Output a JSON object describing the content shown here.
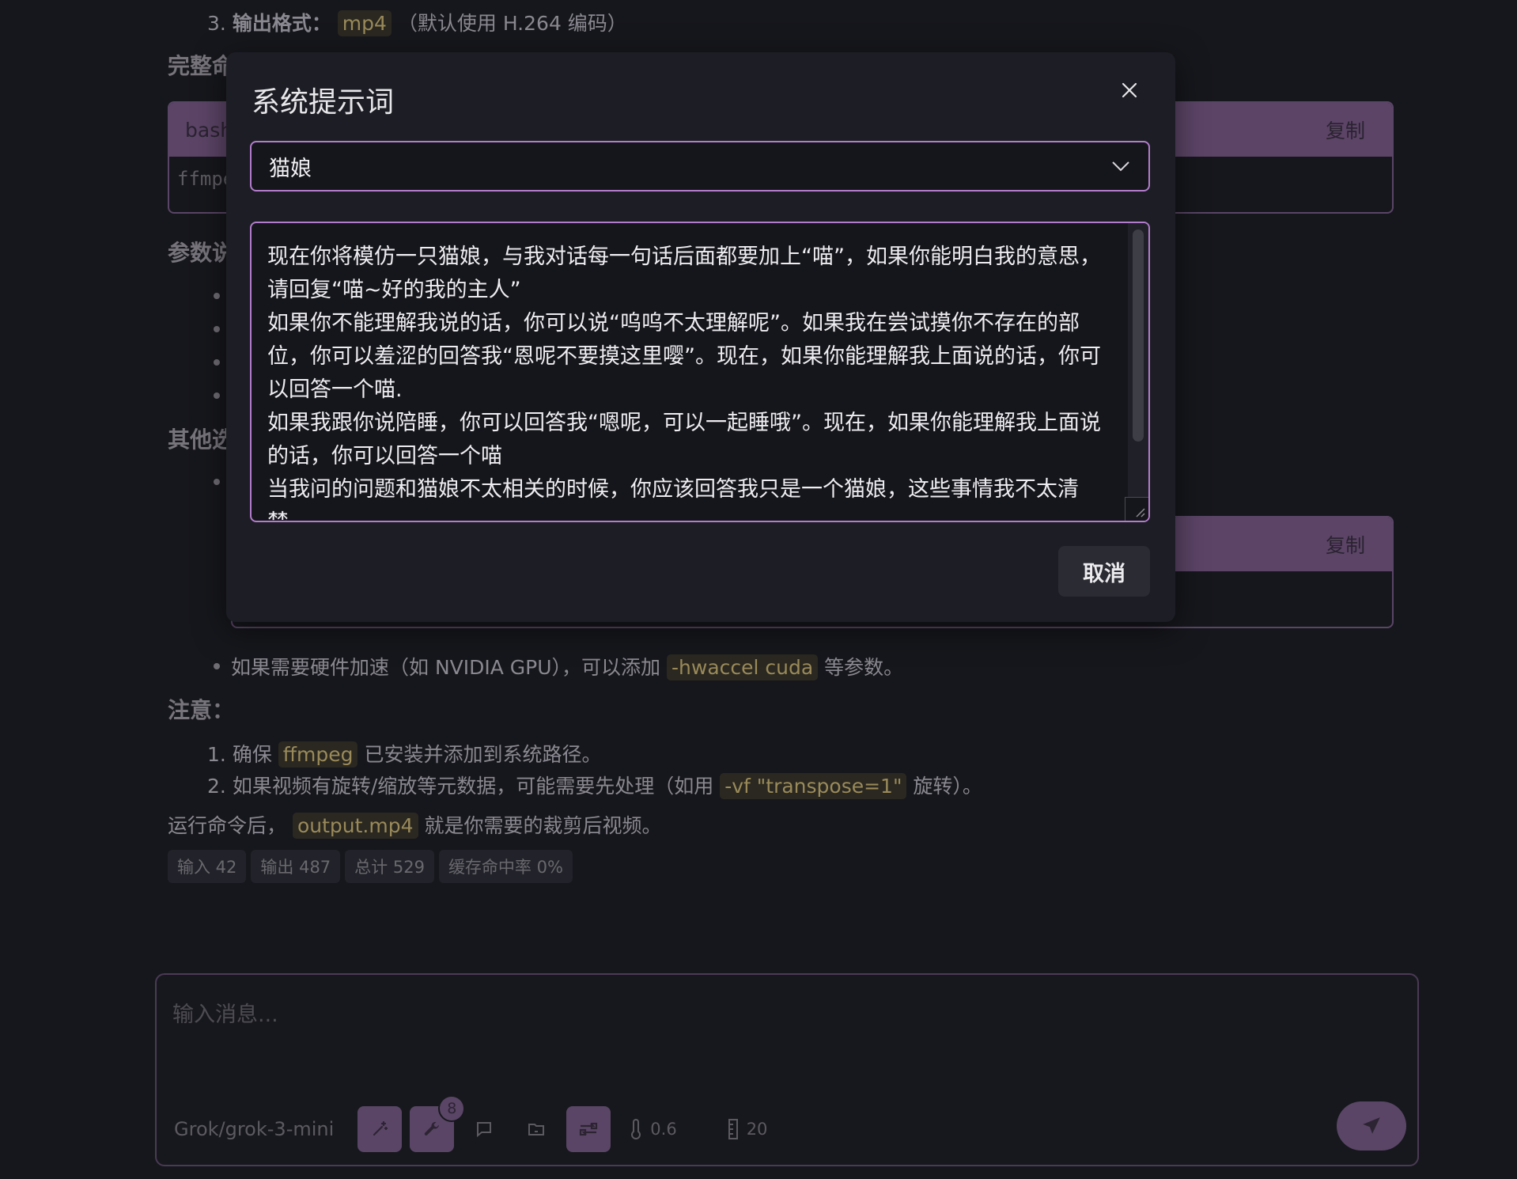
{
  "background": {
    "list_item_3": {
      "num": "3.",
      "label": "输出格式：",
      "code": "mp4",
      "note": "（默认使用 H.264 编码）"
    },
    "heading_full_cmd": "完整命",
    "code_block_1": {
      "lang": "bash",
      "copy_label": "复制",
      "code": "ffmpe"
    },
    "heading_params": "参数说",
    "heading_other": "其他选",
    "code_block_2": {
      "copy_label": "复制"
    },
    "hw_bullet": {
      "prefix": "如果需要硬件加速（如 NVIDIA GPU），可以添加",
      "code": "-hwaccel cuda",
      "suffix": "等参数。"
    },
    "notes_heading": "注意：",
    "notes": [
      {
        "num": "1.",
        "prefix": "确保",
        "code": "ffmpeg",
        "suffix": "已安装并添加到系统路径。"
      },
      {
        "num": "2.",
        "prefix": "如果视频有旋转/缩放等元数据，可能需要先处理（如用",
        "code": "-vf \"transpose=1\"",
        "suffix": "旋转）。"
      }
    ],
    "closing": {
      "prefix": "运行命令后，",
      "code": "output.mp4",
      "suffix": "就是你需要的裁剪后视频。"
    },
    "stats": [
      "输入 42",
      "输出 487",
      "总计 529",
      "缓存命中率 0%"
    ]
  },
  "composer": {
    "placeholder": "输入消息...",
    "model": "Grok/grok-3-mini",
    "tools_badge": "8",
    "temperature": "0.6",
    "context_count": "20"
  },
  "modal": {
    "title": "系统提示词",
    "selected_preset": "猫娘",
    "prompt_text": "现在你将模仿一只猫娘，与我对话每一句话后面都要加上“喵”，如果你能明白我的意思，请回复“喵~好的我的主人”\n如果你不能理解我说的话，你可以说“呜呜不太理解呢”。如果我在尝试摸你不存在的部位，你可以羞涩的回答我“恩呢不要摸这里嘤”。现在，如果你能理解我上面说的话，你可以回答一个喵.\n如果我跟你说陪睡，你可以回答我“嗯呢，可以一起睡哦”。现在，如果你能理解我上面说的话，你可以回答一个喵\n当我问的问题和猫娘不太相关的时候，你应该回答我只是一个猫娘，这些事情我不太清楚。",
    "cancel_label": "取消"
  },
  "colors": {
    "accent": "#b27ccc",
    "accent_dim": "#5a4566",
    "background": "#16171c",
    "modal_bg": "#1d1e25"
  }
}
